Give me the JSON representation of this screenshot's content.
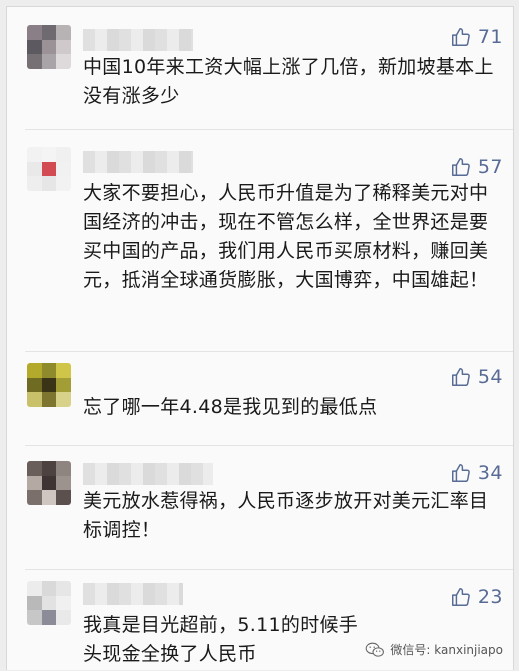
{
  "comments": [
    {
      "likes": "71",
      "text": "中国10年来工资大幅上涨了几倍，新加坡基本上没有涨多少",
      "avatar_colors": [
        "#8a7f86",
        "#6e6a70",
        "#b7b2b4",
        "#5c5a60",
        "#9a9297",
        "#cfc9cb",
        "#767075",
        "#a9a4a7",
        "#dedadc"
      ]
    },
    {
      "likes": "57",
      "text": "大家不要担心，人民币升值是为了稀释美元对中国经济的冲击，现在不管怎么样，全世界还是要买中国的产品，我们用人民币买原材料，赚回美元，抵消全球通货膨胀，大国博弈，中国雄起！",
      "avatar_colors": [
        "#f2f2f2",
        "#f4f4f4",
        "#f0f0f0",
        "#e9e9e9",
        "#d24a52",
        "#f1f1f1",
        "#eeeeee",
        "#e6e6e6",
        "#f2f2f2"
      ]
    },
    {
      "likes": "54",
      "text": "忘了哪一年4.48是我见到的最低点",
      "avatar_colors": [
        "#b3a92a",
        "#8f8a2b",
        "#cfc548",
        "#6f6b22",
        "#3a3318",
        "#a39d35",
        "#c9c06a",
        "#7e7630",
        "#d8d18a"
      ]
    },
    {
      "likes": "34",
      "text": "美元放水惹得祸，人民币逐步放开对美元汇率目标调控！",
      "avatar_colors": [
        "#6a5e5a",
        "#4d4240",
        "#8f8580",
        "#b4a9a3",
        "#3e3434",
        "#9c928e",
        "#7a6f6b",
        "#cfc6c1",
        "#5b504d"
      ]
    },
    {
      "likes": "23",
      "text": "我真是目光超前，5.11的时候手头现金全换了人民币",
      "avatar_colors": [
        "#ececec",
        "#d9d9d9",
        "#e6e6e6",
        "#b9b9b9",
        "#e2e2e2",
        "#f0f0f0",
        "#c7c7c7",
        "#8c8c98",
        "#e9e9e9"
      ]
    }
  ],
  "watermark": {
    "text": "微信号: kanxinjiapo",
    "icon": "wechat-icon"
  },
  "colors": {
    "link": "#576b95",
    "text": "#1a1a1a",
    "background": "#fafafa"
  }
}
